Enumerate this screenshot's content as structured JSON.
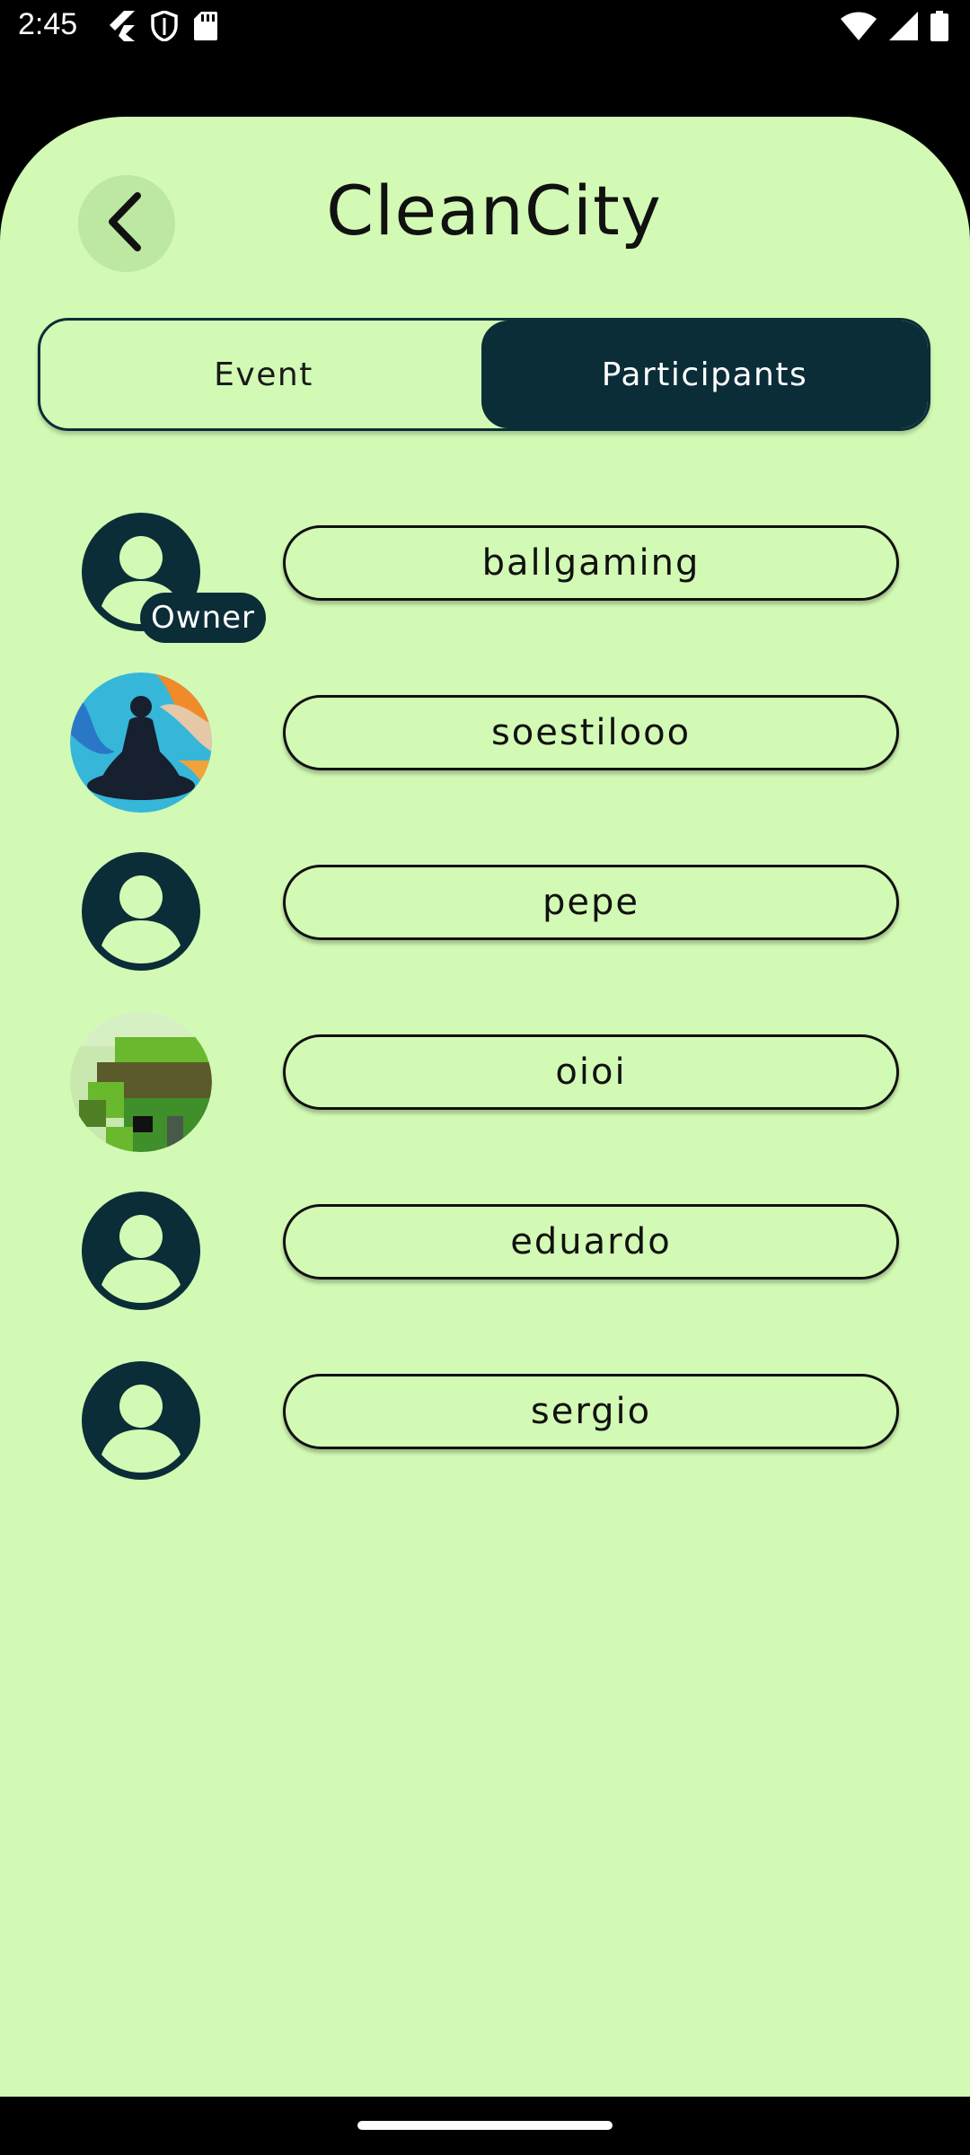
{
  "status_bar": {
    "time": "2:45",
    "icons_left": [
      "flutter-icon",
      "shield-icon",
      "sd-card-icon"
    ],
    "icons_right": [
      "wifi-icon",
      "signal-icon",
      "battery-icon"
    ]
  },
  "header": {
    "title": "CleanCity",
    "back_icon": "chevron-left-icon"
  },
  "tabs": [
    {
      "label": "Event",
      "selected": false
    },
    {
      "label": "Participants",
      "selected": true
    }
  ],
  "participants": [
    {
      "name": "ballgaming",
      "avatar": "default-person-icon",
      "badge": "Owner"
    },
    {
      "name": "soestilooo",
      "avatar": "meditation-photo"
    },
    {
      "name": "pepe",
      "avatar": "default-person-icon"
    },
    {
      "name": "oioi",
      "avatar": "pixel-art-photo"
    },
    {
      "name": "eduardo",
      "avatar": "default-person-icon"
    },
    {
      "name": "sergio",
      "avatar": "default-person-icon"
    }
  ],
  "colors": {
    "background": "#d2fab4",
    "accent": "#0b2d38",
    "back_button_bg": "#bde8a2"
  }
}
